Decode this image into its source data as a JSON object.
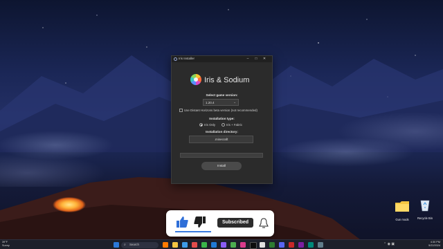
{
  "window": {
    "title": "Iris Installer",
    "app_title": "Iris & Sodium",
    "controls": [
      "–",
      "□",
      "✕"
    ]
  },
  "installer": {
    "version_label": "Select game version:",
    "version_value": "1.20.4",
    "distant_horizons_label": "Use Distant Horizons beta version (not recommended)",
    "distant_horizons_checked": false,
    "install_type_label": "Installation type:",
    "install_options": [
      {
        "label": "Iris Only",
        "selected": true
      },
      {
        "label": "Iris + Fabric",
        "selected": false
      }
    ],
    "directory_label": "Installation directory:",
    "directory_value": ".minecraft",
    "progress": 0,
    "install_button": "Install"
  },
  "overlay": {
    "subscribe_label": "Subscribed",
    "like_icon": "thumbs-up-icon",
    "dislike_icon": "thumbs-down-icon",
    "bell_icon": "bell-icon"
  },
  "desktop_icons": [
    {
      "label": "Gun mods",
      "icon": "folder-icon"
    },
    {
      "label": "Recycle Bin",
      "icon": "recycle-bin-icon"
    }
  ],
  "taskbar": {
    "weather_temp": "39°F",
    "weather_text": "Sunny",
    "search_placeholder": "Search",
    "time": "4:30 PM",
    "date": "5/22/2024"
  },
  "colors": {
    "accent": "#3a7be0",
    "dialog_bg": "#2b2b2b",
    "taskbar_bg": "#1c1f2a"
  }
}
